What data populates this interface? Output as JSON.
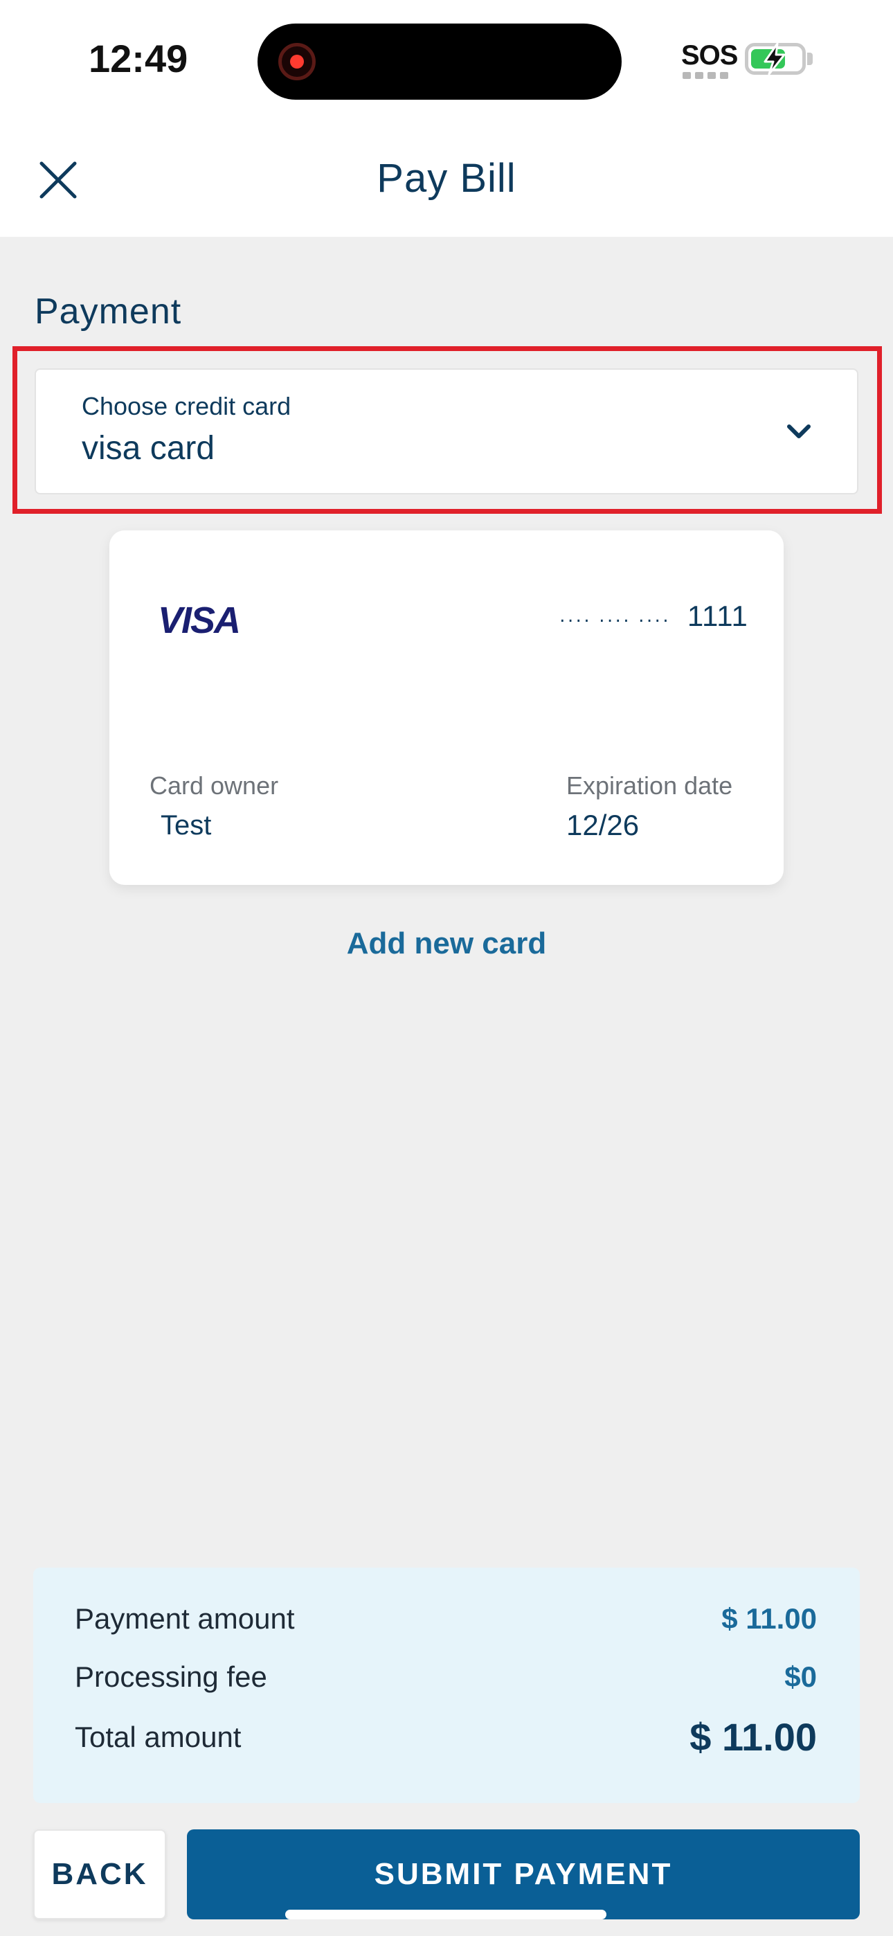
{
  "status_bar": {
    "time": "12:49",
    "carrier_status": "SOS",
    "battery_charging": true,
    "battery_level_percent": 70,
    "screen_recording": true
  },
  "header": {
    "title": "Pay Bill",
    "close_icon": "close-icon"
  },
  "payment": {
    "section_title": "Payment",
    "select": {
      "label": "Choose credit card",
      "value": "visa card",
      "chevron_icon": "chevron-down-icon"
    },
    "card": {
      "brand": "VISA",
      "mask": "․․․․ ․․․․ ․․․․",
      "last4": "1111",
      "owner_label": "Card owner",
      "owner_value": "Test",
      "expiration_label": "Expiration date",
      "expiration_value": "12/26"
    },
    "add_card_label": "Add new card"
  },
  "summary": {
    "rows": [
      {
        "label": "Payment amount",
        "value": "$ 11.00"
      },
      {
        "label": "Processing fee",
        "value": "$0"
      },
      {
        "label": "Total amount",
        "value": "$ 11.00"
      }
    ]
  },
  "actions": {
    "back_label": "BACK",
    "submit_label": "SUBMIT PAYMENT"
  },
  "colors": {
    "primary": "#0a5f96",
    "text_dark": "#0e3a5c",
    "link": "#1a6a9a",
    "highlight": "#e0202a",
    "summary_bg": "#e6f4fa",
    "page_bg": "#efefef"
  }
}
